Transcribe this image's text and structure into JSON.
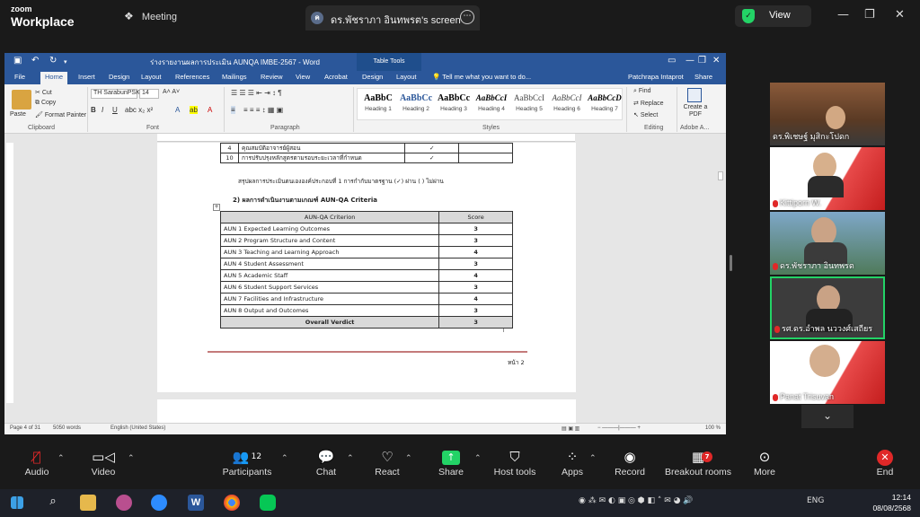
{
  "zoom": {
    "logo_line1": "zoom",
    "logo_line2": "Workplace",
    "meeting_label": "Meeting",
    "share_avatar": "ค",
    "share_title": "ดร.พัชราภา อินทพรต's screen",
    "view_label": "View",
    "toolbar": [
      {
        "name": "audio",
        "label": "Audio",
        "icon": "mic-muted-icon"
      },
      {
        "name": "video",
        "label": "Video",
        "icon": "camera-icon"
      },
      {
        "name": "participants",
        "label": "Participants",
        "icon": "people-icon",
        "count": "12"
      },
      {
        "name": "chat",
        "label": "Chat",
        "icon": "chat-icon"
      },
      {
        "name": "react",
        "label": "React",
        "icon": "heart-icon"
      },
      {
        "name": "share",
        "label": "Share",
        "icon": "share-arrow-icon"
      },
      {
        "name": "host-tools",
        "label": "Host tools",
        "icon": "shield-icon"
      },
      {
        "name": "apps",
        "label": "Apps",
        "icon": "apps-icon"
      },
      {
        "name": "record",
        "label": "Record",
        "icon": "record-icon"
      },
      {
        "name": "breakout-rooms",
        "label": "Breakout rooms",
        "icon": "grid-icon",
        "badge": "7"
      },
      {
        "name": "more",
        "label": "More",
        "icon": "more-icon"
      },
      {
        "name": "end",
        "label": "End",
        "icon": "close-icon"
      }
    ],
    "participants": [
      {
        "name": "ดร.พิเชษฐ์ มุสิกะโปดก",
        "muted": false
      },
      {
        "name": "Kittiporn W.",
        "muted": true
      },
      {
        "name": "ดร.พัชราภา อินทพรต",
        "muted": true
      },
      {
        "name": "รศ.ดร.อำพล นววงศ์เสถียร",
        "muted": true
      },
      {
        "name": "Panat Trisuvan",
        "muted": true
      }
    ]
  },
  "word": {
    "doc_title": "ร่างรายงานผลการประเมิน AUNQA IMBE-2567 - Word",
    "table_tools": "Table Tools",
    "menu": [
      "File",
      "Home",
      "Insert",
      "Design",
      "Layout",
      "References",
      "Mailings",
      "Review",
      "View",
      "Acrobat",
      "Design",
      "Layout"
    ],
    "tell_me": "Tell me what you want to do...",
    "user": "Patchrapa Intaprot",
    "share": "Share",
    "clipboard": {
      "paste": "Paste",
      "cut": "Cut",
      "copy": "Copy",
      "format_painter": "Format Painter",
      "group": "Clipboard"
    },
    "font": {
      "name": "TH SarabunPSK",
      "size": "14",
      "group": "Font"
    },
    "paragraph_group": "Paragraph",
    "styles": [
      {
        "preview": "AaBbC",
        "label": "Heading 1"
      },
      {
        "preview": "AaBbCc",
        "label": "Heading 2"
      },
      {
        "preview": "AaBbCc",
        "label": "Heading 3"
      },
      {
        "preview": "AaBbCcI",
        "label": "Heading 4"
      },
      {
        "preview": "AaBbCcI",
        "label": "Heading 5"
      },
      {
        "preview": "AaBbCcI",
        "label": "Heading 6"
      },
      {
        "preview": "AaBbCcD",
        "label": "Heading 7"
      }
    ],
    "styles_group": "Styles",
    "editing": {
      "find": "Find",
      "replace": "Replace",
      "select": "Select",
      "group": "Editing"
    },
    "adobe": {
      "label": "Create a PDF",
      "group": "Adobe A..."
    },
    "top_table": [
      {
        "no": "4",
        "item": "คุณสมบัติอาจารย์ผู้สอน",
        "check": "✓"
      },
      {
        "no": "10",
        "item": "การปรับปรุงหลักสูตรตามรอบระยะเวลาที่กำหนด",
        "check": "✓"
      }
    ],
    "summary_line": "สรุปผลการประเมินตนเององค์ประกอบที่ 1 การกำกับมาตรฐาน (✓) ผ่าน   (   ) ไม่ผ่าน",
    "section_heading": "2) ผลการดำเนินงานตามเกณฑ์ AUN-QA Criteria",
    "aun_header": [
      "AUN-QA Criterion",
      "Score"
    ],
    "aun_rows": [
      {
        "criterion": "AUN 1 Expected Learning Outcomes",
        "score": "3"
      },
      {
        "criterion": "AUN 2 Program Structure and Content",
        "score": "3"
      },
      {
        "criterion": "AUN 3 Teaching and Learning Approach",
        "score": "4"
      },
      {
        "criterion": "AUN 4 Student Assessment",
        "score": "3"
      },
      {
        "criterion": "AUN 5 Academic Staff",
        "score": "4"
      },
      {
        "criterion": "AUN 6 Student Support Services",
        "score": "3"
      },
      {
        "criterion": "AUN 7 Facilities and Infrastructure",
        "score": "4"
      },
      {
        "criterion": "AUN 8 Output and Outcomes",
        "score": "3"
      }
    ],
    "verdict": {
      "label": "Overall Verdict",
      "score": "3"
    },
    "page_footer": "หน้า 2",
    "status": {
      "page": "Page 4 of 31",
      "words": "5050 words",
      "lang": "English (United States)",
      "zoom": "100 %"
    }
  },
  "taskbar": {
    "lang": "ENG",
    "time": "12:14",
    "date": "08/08/2568"
  },
  "colors": {
    "word_blue": "#2b579a",
    "zoom_green": "#23d366",
    "end_red": "#e02828"
  }
}
